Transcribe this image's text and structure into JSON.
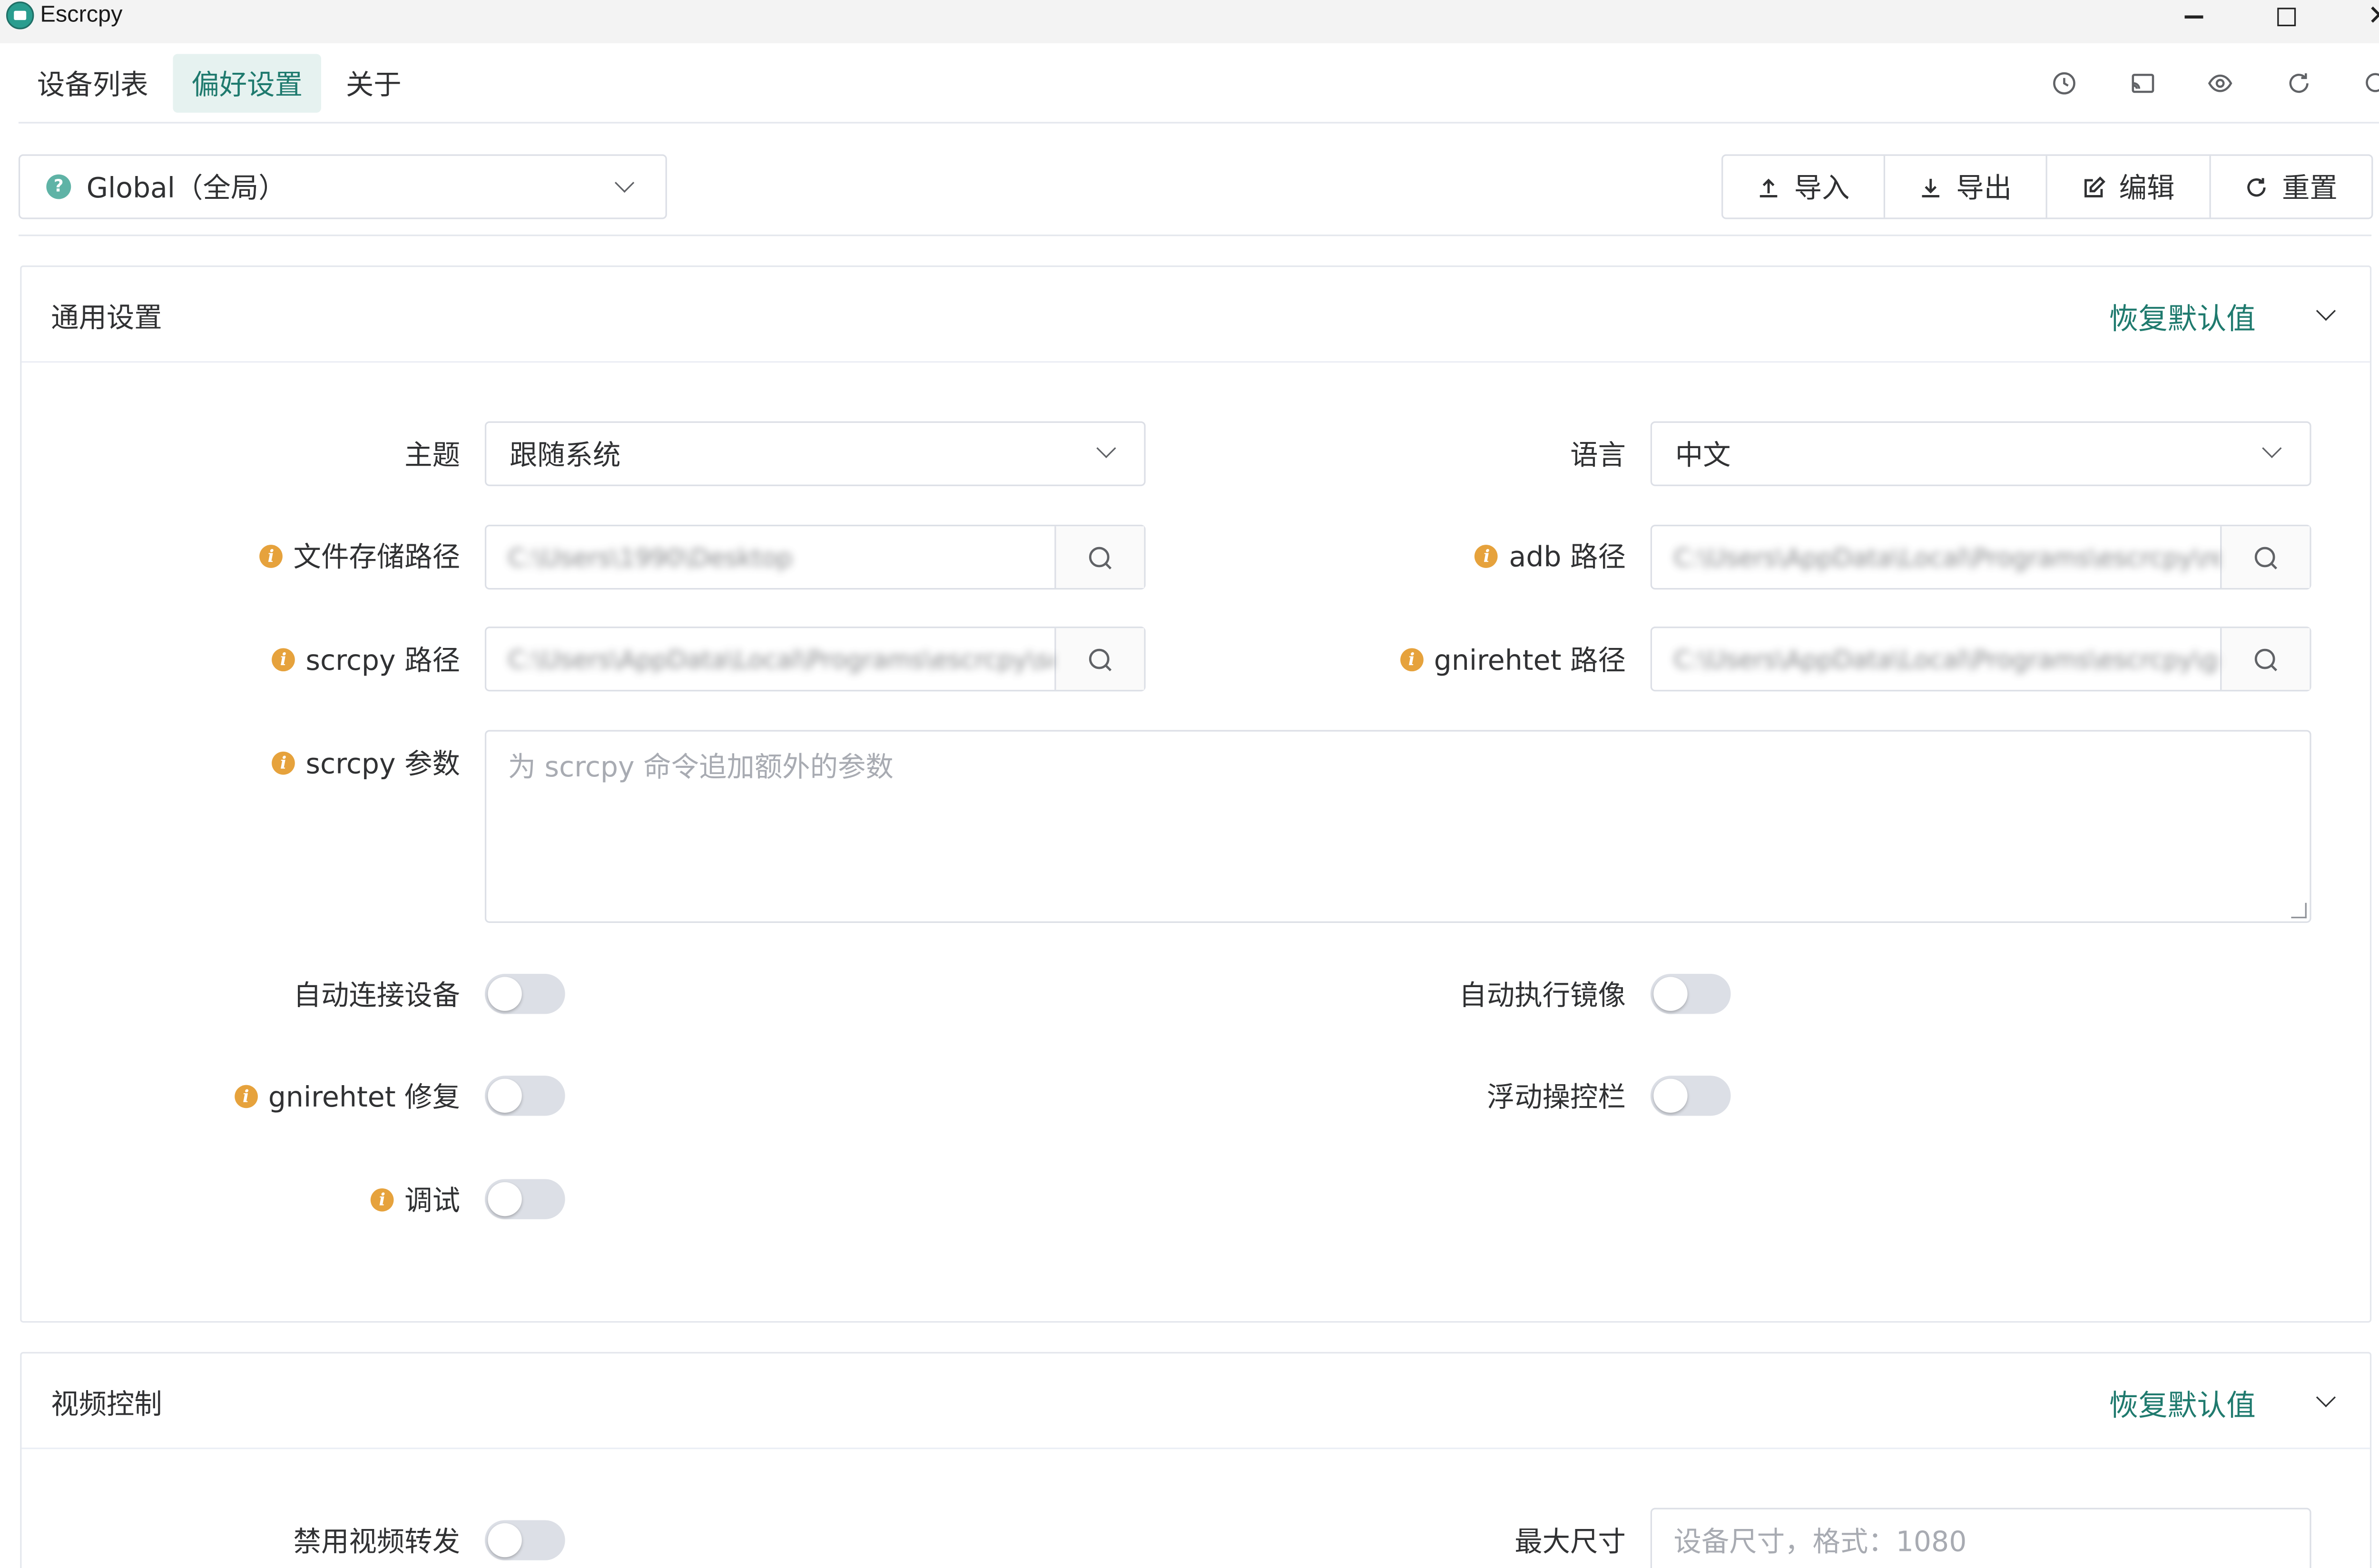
{
  "window": {
    "title": "Escrcpy"
  },
  "nav": {
    "tabs": [
      {
        "label": "设备列表"
      },
      {
        "label": "偏好设置"
      },
      {
        "label": "关于"
      }
    ],
    "active_tab": "偏好设置"
  },
  "config_scope": {
    "selected": "Global（全局）"
  },
  "actions": {
    "import_label": "导入",
    "export_label": "导出",
    "edit_label": "编辑",
    "reset_label": "重置"
  },
  "general": {
    "title": "通用设置",
    "restore_label": "恢复默认值",
    "theme": {
      "label": "主题",
      "value": "跟随系统"
    },
    "language": {
      "label": "语言",
      "value": "中文"
    },
    "file_path": {
      "label": "文件存储路径",
      "value": "C:\\Users\\1990\\Desktop"
    },
    "adb_path": {
      "label": "adb 路径",
      "value": "C:\\Users\\AppData\\Local\\Programs\\escrcpy\\resources\\extra\\win\\adb.exe"
    },
    "scrcpy_path": {
      "label": "scrcpy 路径",
      "value": "C:\\Users\\AppData\\Local\\Programs\\escrcpy\\scrcpy.exe"
    },
    "gnirehtet_path": {
      "label": "gnirehtet 路径",
      "value": "C:\\Users\\AppData\\Local\\Programs\\escrcpy\\gnirehtet.exe"
    },
    "scrcpy_args": {
      "label": "scrcpy 参数",
      "placeholder": "为 scrcpy 命令追加额外的参数"
    },
    "auto_connect": {
      "label": "自动连接设备",
      "on": false
    },
    "auto_mirror": {
      "label": "自动执行镜像",
      "on": false
    },
    "gnirehtet_fix": {
      "label": "gnirehtet 修复",
      "on": false
    },
    "floating_bar": {
      "label": "浮动操控栏",
      "on": false
    },
    "debug": {
      "label": "调试",
      "on": false
    }
  },
  "video": {
    "title": "视频控制",
    "restore_label": "恢复默认值",
    "disable_video": {
      "label": "禁用视频转发",
      "on": false
    },
    "max_size": {
      "label": "最大尺寸",
      "placeholder": "设备尺寸，格式：1080"
    }
  },
  "colors": {
    "accent": "#1f7a6e",
    "accent_bg": "#e6f2f0",
    "info": "#e6a23c",
    "border": "#dcdfe6"
  },
  "icons": {
    "nav": [
      "history-icon",
      "cast-icon",
      "eye-icon",
      "refresh-icon",
      "search-icon"
    ]
  }
}
